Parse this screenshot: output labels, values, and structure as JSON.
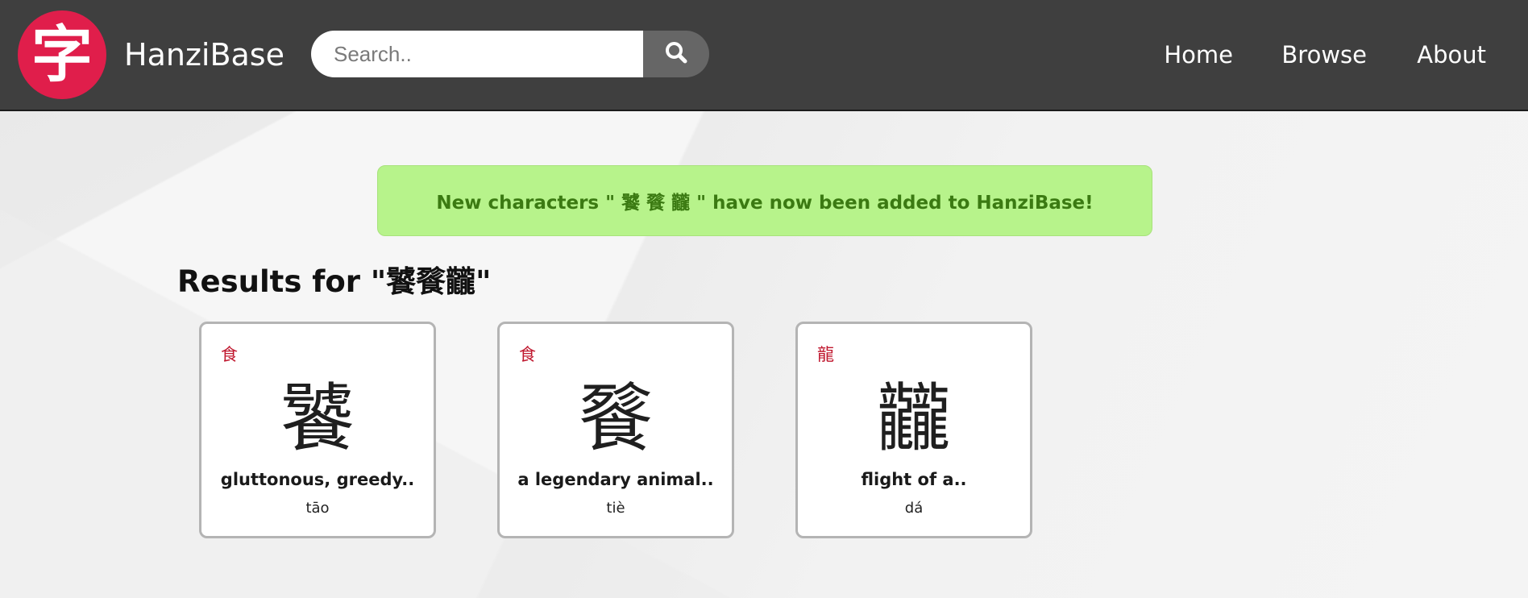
{
  "header": {
    "logo_glyph": "字",
    "brand": "HanziBase",
    "search": {
      "placeholder": "Search..",
      "value": ""
    },
    "search_icon": "search-icon",
    "nav": [
      {
        "label": "Home"
      },
      {
        "label": "Browse"
      },
      {
        "label": "About"
      }
    ]
  },
  "banner": {
    "text": "New characters \" 饕 餮 龖 \" have now been added to HanziBase!"
  },
  "results": {
    "title": "Results for \"饕餮龖\""
  },
  "cards": [
    {
      "radical": "食",
      "character": "饕",
      "meaning": "gluttonous, greedy..",
      "pinyin": "tāo"
    },
    {
      "radical": "食",
      "character": "餮",
      "meaning": "a legendary animal..",
      "pinyin": "tiè"
    },
    {
      "radical": "龍",
      "character": "龖",
      "meaning": "flight of a..",
      "pinyin": "dá"
    }
  ],
  "colors": {
    "header_bg": "#3f3f3f",
    "logo_red": "#e01e4b",
    "banner_bg": "#b7f38b",
    "banner_text": "#3b7a12",
    "radical_red": "#c0182f"
  }
}
